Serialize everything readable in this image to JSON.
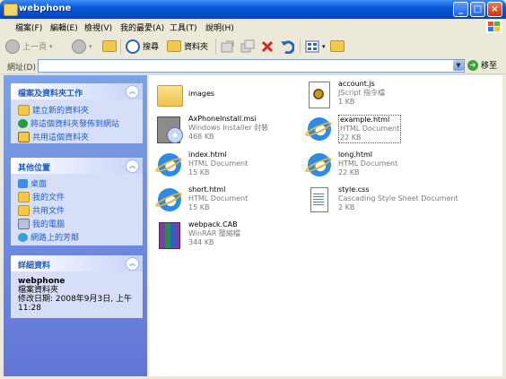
{
  "window": {
    "title": "webphone"
  },
  "menu": [
    "檔案(F)",
    "編輯(E)",
    "檢視(V)",
    "我的最愛(A)",
    "工具(T)",
    "說明(H)"
  ],
  "toolbar": {
    "back_label": "上一頁",
    "search_label": "搜尋",
    "folders_label": "資料夾"
  },
  "address": {
    "label": "網址(D)",
    "value": "",
    "go_label": "移至"
  },
  "tasks_panel": {
    "title": "檔案及資料夾工作",
    "links": [
      "建立新的資料夾",
      "將這個資料夾發佈到網站",
      "共用這個資料夾"
    ]
  },
  "places_panel": {
    "title": "其他位置",
    "links": [
      "桌面",
      "我的文件",
      "共用文件",
      "我的電腦",
      "網路上的芳鄰"
    ]
  },
  "details_panel": {
    "title": "詳細資料",
    "name": "webphone",
    "type": "檔案資料夾",
    "modified_line1": "修改日期: 2008年9月3日, 上午",
    "modified_line2": "11:28"
  },
  "files": [
    {
      "name": "images",
      "type": "",
      "size": "",
      "icon": "folder-icon"
    },
    {
      "name": "account.js",
      "type": "JScript 指令檔",
      "size": "1 KB",
      "icon": "jscript-file-icon"
    },
    {
      "name": "AxPhoneInstall.msi",
      "type": "Windows Installer 封裝",
      "size": "468 KB",
      "icon": "msi-installer-icon"
    },
    {
      "name": "example.html",
      "type": "HTML Document",
      "size": "22 KB",
      "icon": "ie-html-icon"
    },
    {
      "name": "index.html",
      "type": "HTML Document",
      "size": "15 KB",
      "icon": "ie-html-icon"
    },
    {
      "name": "long.html",
      "type": "HTML Document",
      "size": "22 KB",
      "icon": "ie-html-icon"
    },
    {
      "name": "short.html",
      "type": "HTML Document",
      "size": "15 KB",
      "icon": "ie-html-icon"
    },
    {
      "name": "style.css",
      "type": "Cascading Style Sheet Document",
      "size": "2 KB",
      "icon": "css-file-icon"
    },
    {
      "name": "webpack.CAB",
      "type": "WinRAR 壓縮檔",
      "size": "344 KB",
      "icon": "winrar-archive-icon"
    }
  ]
}
